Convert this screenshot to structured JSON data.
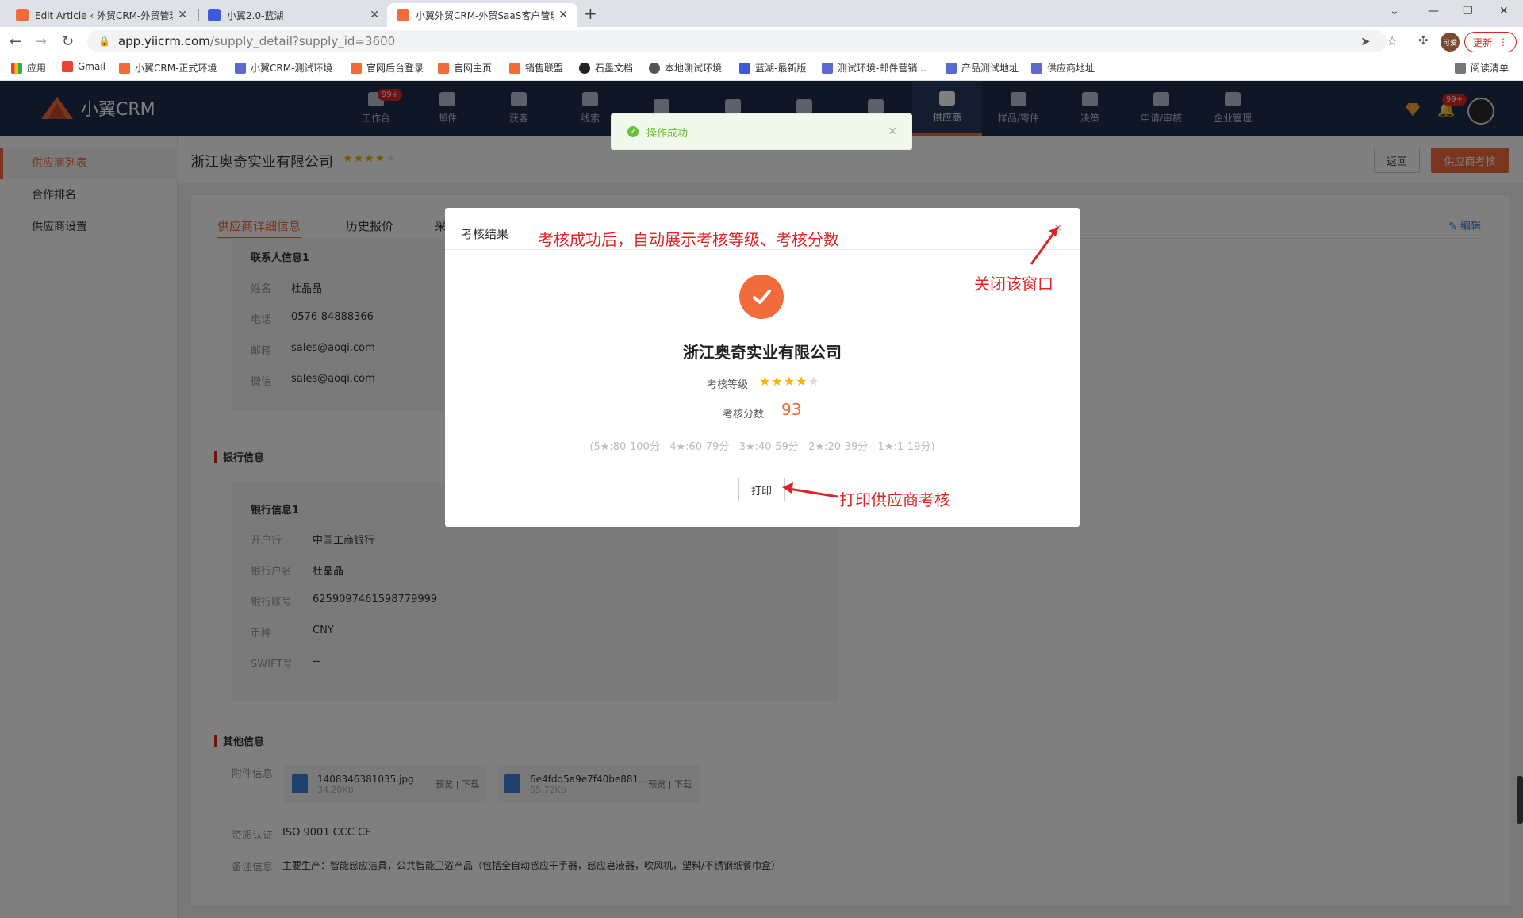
{
  "browser": {
    "tabs": [
      {
        "title": "Edit Article ‹ 外贸CRM-外贸管理",
        "active": false
      },
      {
        "title": "小翼2.0-蓝湖",
        "active": false
      },
      {
        "title": "小翼外贸CRM-外贸SaaS客户管理",
        "active": true
      }
    ],
    "url_host": "app.yiicrm.com",
    "url_path": "/supply_detail?supply_id=3600",
    "profile": "可爱",
    "update_label": "更新",
    "bookmarks": [
      "应用",
      "Gmail",
      "小翼CRM-正式环境",
      "小翼CRM-测试环境",
      "官网后台登录",
      "官网主页",
      "销售联盟",
      "石墨文档",
      "本地测试环境",
      "蓝湖-最新版",
      "测试环境-邮件营销...",
      "产品测试地址",
      "供应商地址"
    ],
    "reading_list": "阅读清单"
  },
  "app": {
    "logo": "小翼CRM",
    "nav": [
      {
        "label": "工作台",
        "badge": "99+"
      },
      {
        "label": "邮件"
      },
      {
        "label": "获客"
      },
      {
        "label": "线索"
      },
      {
        "label": ""
      },
      {
        "label": ""
      },
      {
        "label": ""
      },
      {
        "label": ""
      },
      {
        "label": "供应商",
        "active": true
      },
      {
        "label": "样品/寄件"
      },
      {
        "label": "决策"
      },
      {
        "label": "申请/审核"
      },
      {
        "label": "企业管理"
      }
    ],
    "notif_badge": "99+",
    "toast": "操作成功"
  },
  "sidebar": {
    "items": [
      {
        "label": "供应商列表",
        "active": true
      },
      {
        "label": "合作排名"
      },
      {
        "label": "供应商设置"
      }
    ]
  },
  "page": {
    "company": "浙江奥奇实业有限公司",
    "rating": 4,
    "back_label": "返回",
    "assess_label": "供应商考核",
    "edit_label": "编辑",
    "tabs": [
      "供应商详细信息",
      "历史报价",
      "采"
    ],
    "contact": {
      "title": "联系人信息1",
      "rows": [
        {
          "label": "姓名",
          "value": "杜晶晶"
        },
        {
          "label": "电话",
          "value": "0576-84888366"
        },
        {
          "label": "邮箱",
          "value": "sales@aoqi.com"
        },
        {
          "label": "微信",
          "value": "sales@aoqi.com"
        }
      ]
    },
    "bank_section": "银行信息",
    "bank": {
      "title": "银行信息1",
      "rows": [
        {
          "label": "开户行",
          "value": "中国工商银行"
        },
        {
          "label": "银行户名",
          "value": "杜晶晶"
        },
        {
          "label": "银行账号",
          "value": "6259097461598779999"
        },
        {
          "label": "币种",
          "value": "CNY"
        },
        {
          "label": "SWIFT号",
          "value": "--"
        }
      ]
    },
    "other_section": "其他信息",
    "attach_label": "附件信息",
    "files": [
      {
        "name": "1408346381035.jpg",
        "size": "34.20Kb",
        "actions": "预览 | 下载"
      },
      {
        "name": "6e4fdd5a9e7f40be881...",
        "size": "65.72Kb",
        "actions": "预览 | 下载"
      }
    ],
    "cert_label": "资质认证",
    "cert_value": "ISO 9001 CCC CE",
    "note_label": "备注信息",
    "note_value": "主要生产：智能感应洁具，公共智能卫浴产品（包括全自动感应干手器，感应皂液器，吹风机，塑料/不锈钢纸餐巾盒）"
  },
  "modal": {
    "title": "考核结果",
    "company": "浙江奥奇实业有限公司",
    "level_label": "考核等级",
    "level": 4,
    "score_label": "考核分数",
    "score": "93",
    "legend": "(5★:80-100分   4★:60-79分   3★:40-59分   2★:20-39分   1★:1-19分)",
    "print_label": "打印"
  },
  "annotations": {
    "top": "考核成功后，自动展示考核等级、考核分数",
    "close": "关闭该窗口",
    "print": "打印供应商考核"
  },
  "colors": {
    "accent": "#f26b3a",
    "header": "#1e2d4a",
    "annotation": "#e02424",
    "success": "#67c23a"
  }
}
